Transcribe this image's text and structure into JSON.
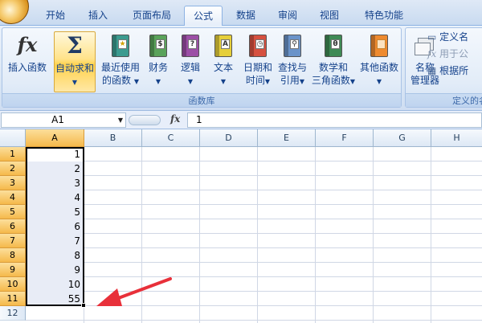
{
  "tabs": [
    "开始",
    "插入",
    "页面布局",
    "公式",
    "数据",
    "审阅",
    "视图",
    "特色功能"
  ],
  "active_tab": "公式",
  "ribbon": {
    "function_library": {
      "group_label": "函数库",
      "insert_function": {
        "label": "插入函数",
        "icon": "fx-icon"
      },
      "autosum": {
        "label": "自动求和",
        "icon": "sigma-icon"
      },
      "recent": {
        "label1": "最近使用",
        "label2": "的函数",
        "icon": "book-star-icon"
      },
      "financial": {
        "label1": "财务",
        "icon": "book-coins-icon"
      },
      "logical": {
        "label1": "逻辑",
        "icon": "book-question-icon"
      },
      "text": {
        "label1": "文本",
        "icon": "book-letter-icon"
      },
      "datetime": {
        "label1": "日期和",
        "label2": "时间",
        "icon": "book-clock-icon"
      },
      "lookup": {
        "label1": "查找与",
        "label2": "引用",
        "icon": "book-search-icon"
      },
      "math": {
        "label1": "数学和",
        "label2": "三角函数",
        "icon": "book-theta-icon"
      },
      "more": {
        "label1": "其他函数",
        "icon": "books-icon"
      }
    },
    "defined_names": {
      "group_label": "定义的名",
      "name_manager": {
        "label1": "名称",
        "label2": "管理器",
        "icon": "name-manager-icon"
      },
      "define_name": "定义名",
      "use_in_formula": "用于公",
      "create_from_selection": "根据所"
    }
  },
  "formula_bar": {
    "name_box": "A1",
    "fx": "fx",
    "value": "1"
  },
  "columns": [
    "A",
    "B",
    "C",
    "D",
    "E",
    "F",
    "G",
    "H"
  ],
  "rows": [
    "1",
    "2",
    "3",
    "4",
    "5",
    "6",
    "7",
    "8",
    "9",
    "10",
    "11",
    "12"
  ],
  "column_a_values": [
    "1",
    "2",
    "3",
    "4",
    "5",
    "6",
    "7",
    "8",
    "9",
    "10",
    "55"
  ],
  "colors": {
    "accent": "#15428b",
    "selection": "#e8ecf6",
    "header_selected": "#f5b94b",
    "arrow": "#e8303a"
  }
}
